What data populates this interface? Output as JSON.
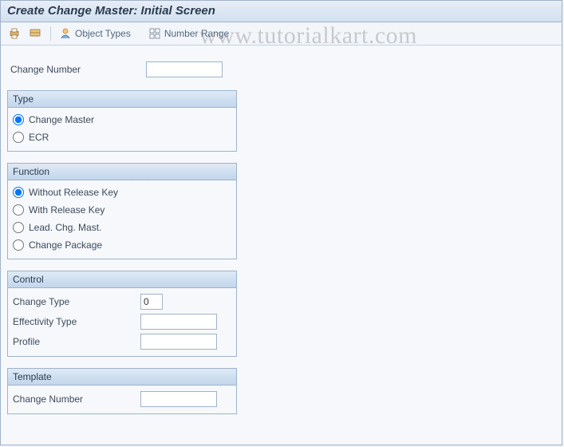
{
  "title": "Create Change Master: Initial Screen",
  "toolbar": {
    "object_types_label": "Object Types",
    "number_range_label": "Number Range"
  },
  "change_number": {
    "label": "Change Number",
    "value": ""
  },
  "type_group": {
    "title": "Type",
    "options": [
      {
        "label": "Change Master",
        "selected": true
      },
      {
        "label": "ECR",
        "selected": false
      }
    ]
  },
  "function_group": {
    "title": "Function",
    "options": [
      {
        "label": "Without Release Key",
        "selected": true
      },
      {
        "label": "With Release Key",
        "selected": false
      },
      {
        "label": "Lead. Chg. Mast.",
        "selected": false
      },
      {
        "label": "Change Package",
        "selected": false
      }
    ]
  },
  "control_group": {
    "title": "Control",
    "change_type": {
      "label": "Change Type",
      "value": "0"
    },
    "effectivity_type": {
      "label": "Effectivity Type",
      "value": ""
    },
    "profile": {
      "label": "Profile",
      "value": ""
    }
  },
  "template_group": {
    "title": "Template",
    "change_number": {
      "label": "Change Number",
      "value": ""
    }
  },
  "watermark": "www.tutorialkart.com"
}
